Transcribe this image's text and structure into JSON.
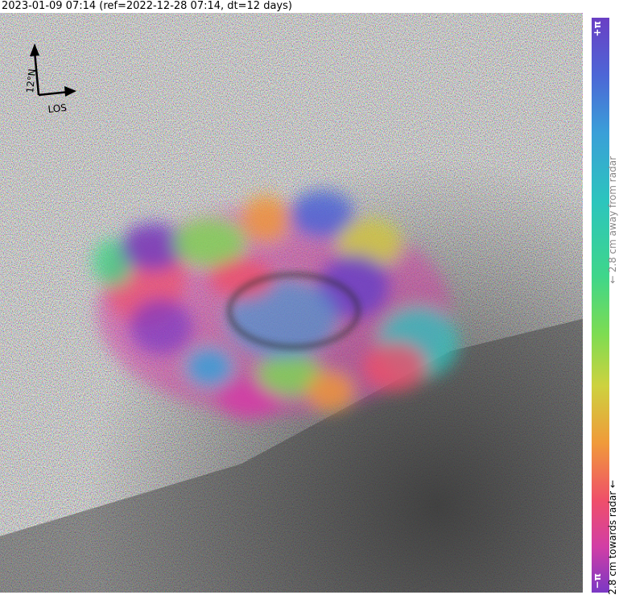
{
  "header": {
    "title": "2023-01-09 07:14 (ref=2022-12-28 07:14, dt=12 days)"
  },
  "compass": {
    "north_label": "12°N",
    "los_label": "LOS"
  },
  "colorbar": {
    "top_label": "+π",
    "bottom_label": "−π",
    "away_label": "2.8 cm away from radar",
    "towards_label": "2.8 cm towards radar",
    "away_arrow": "←",
    "towards_arrow": "←"
  },
  "colors": {
    "cbar_top": "#6a3fc4",
    "cbar_mid_green": "#3fd68a",
    "cbar_orange": "#f09a3a",
    "cbar_bottom": "#7a38c4"
  }
}
